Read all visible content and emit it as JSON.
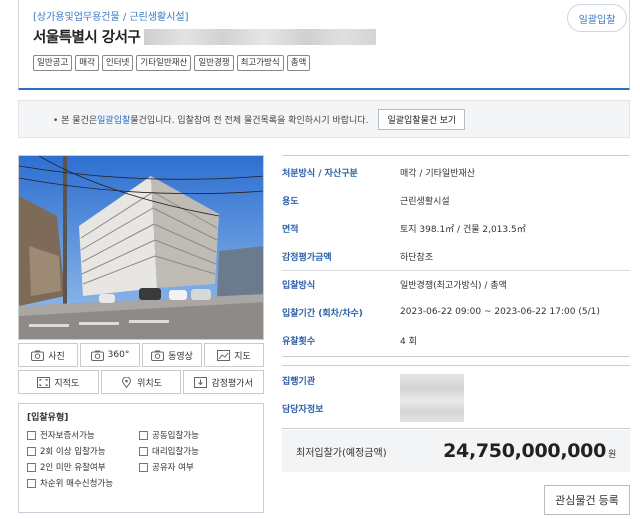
{
  "header": {
    "category": "[상가용및업무용건물 / 근린생활시설]",
    "address": "서울특별시 강서구",
    "bulk_badge": "일괄입찰",
    "tags": [
      "일반공고",
      "매각",
      "인터넷",
      "기타일반재산",
      "일반경쟁",
      "최고가방식",
      "총액"
    ]
  },
  "notice": {
    "prefix": "• 본 물건은 ",
    "highlight": "일괄입찰",
    "suffix": " 물건입니다. 입찰참여 전 전체 물건목록을 확인하시기 바랍니다.",
    "button": "일괄입찰물건 보기"
  },
  "media_buttons": {
    "photo": "사진",
    "view360": "360°",
    "video": "동영상",
    "map": "지도",
    "cadastral": "지적도",
    "location": "위치도",
    "appraisal": "감정평가서"
  },
  "auction_types": {
    "title": "[입찰유형]",
    "items": [
      "전자보증서가능",
      "공동입찰가능",
      "2회 이상 입찰가능",
      "대리입찰가능",
      "2인 미만 유찰여부",
      "공유자 여부",
      "차순위 매수신청가능"
    ]
  },
  "info": {
    "rows": [
      {
        "label": "처분방식 / 자산구분",
        "value": "매각 / 기타일반재산"
      },
      {
        "label": "용도",
        "value": "근린생활시설"
      },
      {
        "label": "면적",
        "value": "토지 398.1㎡ / 건물 2,013.5㎡"
      },
      {
        "label": "감정평가금액",
        "value": "하단참조"
      },
      {
        "label": "입찰방식",
        "value": "일반경쟁(최고가방식) / 총액"
      },
      {
        "label": "입찰기간 (회차/차수)",
        "value": "2023-06-22 09:00 ~ 2023-06-22 17:00 (5/1)"
      },
      {
        "label": "유찰횟수",
        "value": "4 회"
      }
    ],
    "org_label": "집행기관",
    "manager_label": "담당자정보"
  },
  "price": {
    "label": "최저입찰가(예정금액)",
    "value": "24,750,000,000",
    "unit": "원"
  },
  "watch_button": "관심물건 등록",
  "colors": {
    "accent": "#2b6cc4",
    "label": "#2b5fa8"
  }
}
